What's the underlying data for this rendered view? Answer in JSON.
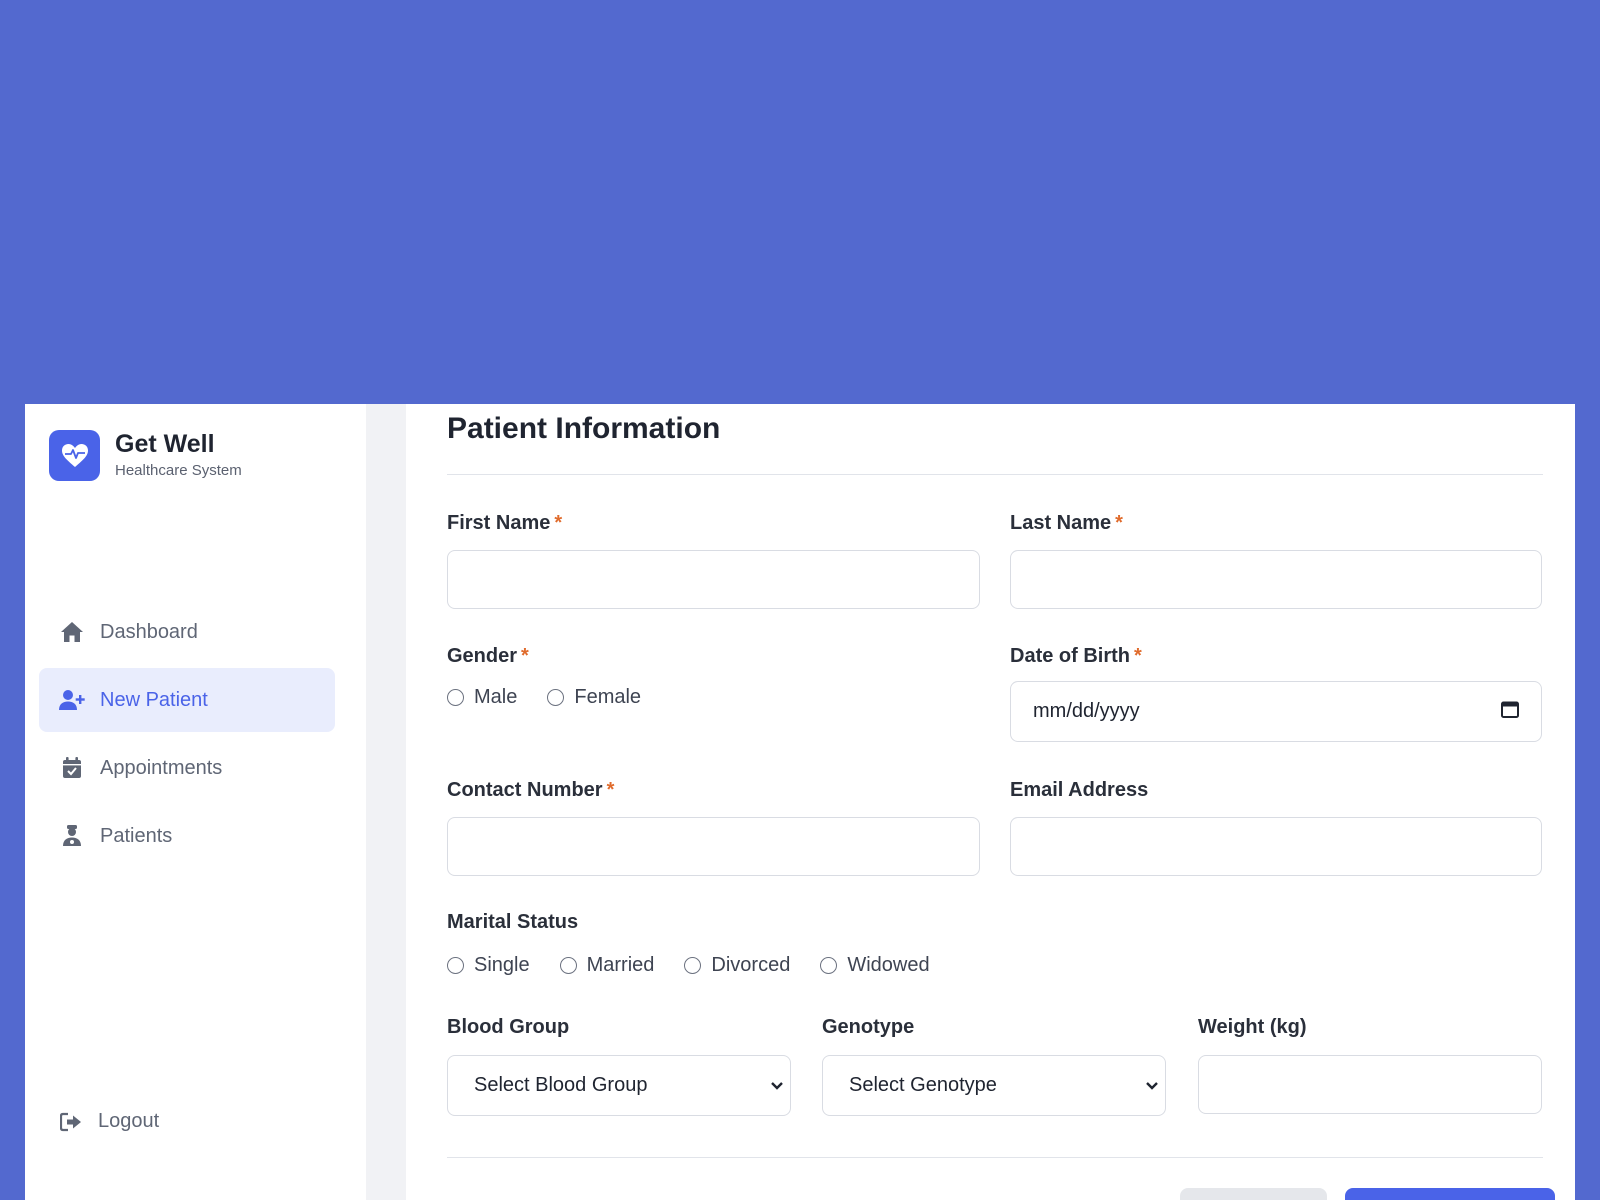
{
  "colors": {
    "backdrop": "#5369cf",
    "accent": "#4a63e8",
    "active_bg": "#e9edfd",
    "required": "#e06b2c"
  },
  "brand": {
    "name": "Get Well",
    "subtitle": "Healthcare System",
    "logo_icon": "heart-pulse-icon"
  },
  "nav": {
    "items": [
      {
        "label": "Dashboard",
        "icon": "home-icon",
        "active": false
      },
      {
        "label": "New Patient",
        "icon": "user-plus-icon",
        "active": true
      },
      {
        "label": "Appointments",
        "icon": "calendar-check-icon",
        "active": false
      },
      {
        "label": "Patients",
        "icon": "user-doctor-icon",
        "active": false
      }
    ],
    "logout": {
      "label": "Logout",
      "icon": "sign-out-icon"
    }
  },
  "form": {
    "title": "Patient Information",
    "first_name": {
      "label": "First Name",
      "required": "*",
      "value": ""
    },
    "last_name": {
      "label": "Last Name",
      "required": "*",
      "value": ""
    },
    "gender": {
      "label": "Gender",
      "required": "*",
      "options": [
        "Male",
        "Female"
      ]
    },
    "dob": {
      "label": "Date of Birth",
      "required": "*",
      "placeholder": "mm/dd/yyyy"
    },
    "contact": {
      "label": "Contact Number",
      "required": "*",
      "value": ""
    },
    "email": {
      "label": "Email Address",
      "value": ""
    },
    "marital": {
      "label": "Marital Status",
      "options": [
        "Single",
        "Married",
        "Divorced",
        "Widowed"
      ]
    },
    "blood_group": {
      "label": "Blood Group",
      "selected": "Select Blood Group"
    },
    "genotype": {
      "label": "Genotype",
      "selected": "Select Genotype"
    },
    "weight": {
      "label": "Weight (kg)",
      "value": ""
    }
  }
}
